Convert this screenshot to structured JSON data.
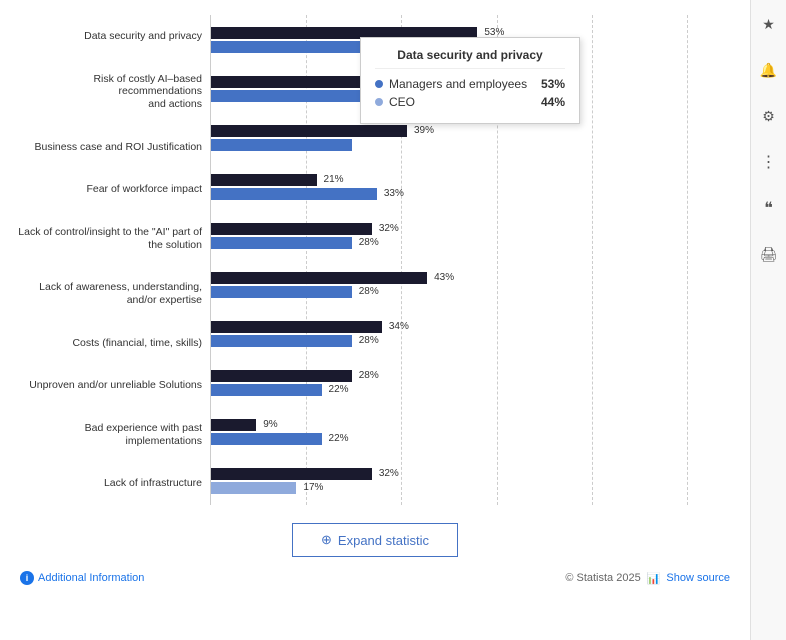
{
  "tooltip": {
    "title": "Data security and privacy",
    "rows": [
      {
        "label": "Managers and employees",
        "value": "53%",
        "color": "#4472c4"
      },
      {
        "label": "CEO",
        "value": "44%",
        "color": "#8faadc"
      }
    ]
  },
  "chart": {
    "categories": [
      {
        "label": "Data security and privacy",
        "bars": [
          {
            "type": "dark",
            "pct": 53,
            "label": "53%"
          },
          {
            "type": "blue",
            "pct": 44,
            "label": "44%"
          }
        ]
      },
      {
        "label": "Risk of costly AI-based recommendations and actions",
        "bars": [
          {
            "type": "dark",
            "pct": 40,
            "label": ""
          },
          {
            "type": "blue",
            "pct": 35,
            "label": ""
          }
        ]
      },
      {
        "label": "Business case and ROI Justification",
        "bars": [
          {
            "type": "dark",
            "pct": 39,
            "label": "39%"
          },
          {
            "type": "blue",
            "pct": 30,
            "label": ""
          }
        ]
      },
      {
        "label": "Fear of workforce impact",
        "bars": [
          {
            "type": "dark",
            "pct": 21,
            "label": "21%"
          },
          {
            "type": "blue",
            "pct": 33,
            "label": "33%"
          }
        ]
      },
      {
        "label": "Lack of control/insight to the \"AI\" part of the solution",
        "bars": [
          {
            "type": "dark",
            "pct": 32,
            "label": "32%"
          },
          {
            "type": "blue",
            "pct": 28,
            "label": "28%"
          }
        ]
      },
      {
        "label": "Lack of awareness, understanding, and/or expertise",
        "bars": [
          {
            "type": "dark",
            "pct": 43,
            "label": "43%"
          },
          {
            "type": "blue",
            "pct": 28,
            "label": "28%"
          }
        ]
      },
      {
        "label": "Costs (financial, time, skills)",
        "bars": [
          {
            "type": "dark",
            "pct": 34,
            "label": "34%"
          },
          {
            "type": "blue",
            "pct": 28,
            "label": "28%"
          }
        ]
      },
      {
        "label": "Unproven and/or unreliable Solutions",
        "bars": [
          {
            "type": "dark",
            "pct": 28,
            "label": "28%"
          },
          {
            "type": "blue",
            "pct": 22,
            "label": "22%"
          }
        ]
      },
      {
        "label": "Bad experience with past implementations",
        "bars": [
          {
            "type": "dark",
            "pct": 9,
            "label": "9%"
          },
          {
            "type": "blue",
            "pct": 22,
            "label": "22%"
          }
        ]
      },
      {
        "label": "Lack of infrastructure",
        "bars": [
          {
            "type": "dark",
            "pct": 32,
            "label": "32%"
          },
          {
            "type": "light",
            "pct": 17,
            "label": "17%"
          }
        ]
      }
    ],
    "max_pct": 55
  },
  "expand_btn": {
    "label": "Expand statistic",
    "icon": "⊕"
  },
  "footer": {
    "info_label": "Additional Information",
    "statista": "© Statista 2025",
    "show_source": "Show source"
  },
  "sidebar": {
    "icons": [
      "★",
      "🔔",
      "⚙",
      "⋮",
      "❝",
      "🖨"
    ]
  }
}
